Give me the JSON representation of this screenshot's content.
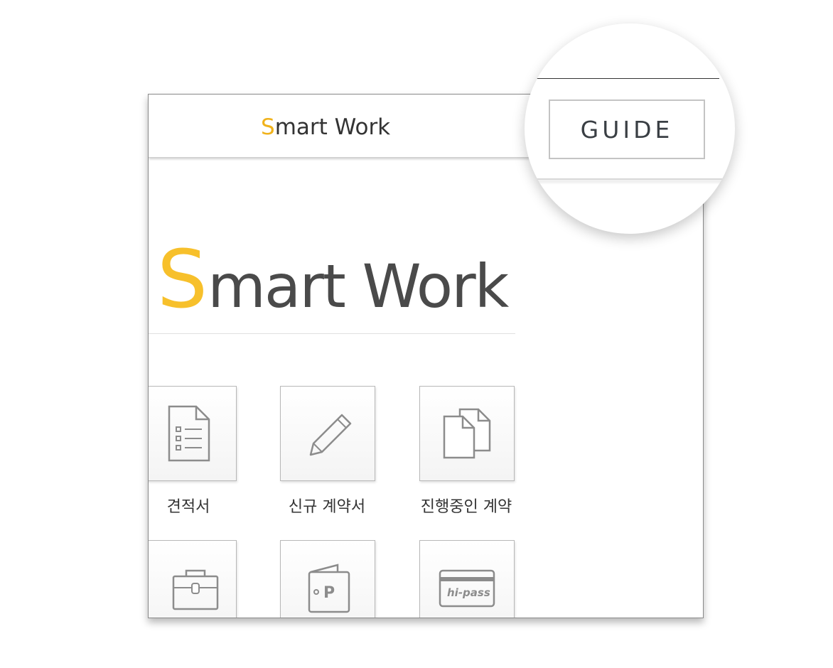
{
  "header": {
    "title_accent": "S",
    "title_rest": "mart Work"
  },
  "hero": {
    "accent": "S",
    "rest": "mart Work"
  },
  "guide": {
    "label": "GUIDE"
  },
  "tiles": [
    {
      "label": "견적서",
      "icon": "document-list-icon"
    },
    {
      "label": "신규 계약서",
      "icon": "pencil-icon"
    },
    {
      "label": "진행중인 계약",
      "icon": "documents-copy-icon"
    },
    {
      "label": "",
      "icon": "briefcase-icon"
    },
    {
      "label": "",
      "icon": "parking-card-icon"
    },
    {
      "label": "",
      "icon": "hipass-card-icon",
      "icon_text": "hi-pass"
    }
  ],
  "colors": {
    "accent": "#f0b21b",
    "hero_accent": "#f7c02b",
    "text": "#4a4a4a"
  }
}
